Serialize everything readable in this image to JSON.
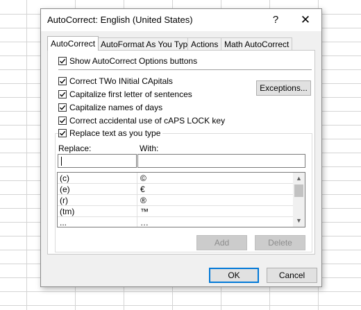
{
  "dialog": {
    "title": "AutoCorrect: English (United States)",
    "help_label": "?",
    "close_label": "✕"
  },
  "tabs": [
    {
      "label": "AutoCorrect",
      "active": true
    },
    {
      "label": "AutoFormat As You Type",
      "active": false
    },
    {
      "label": "Actions",
      "active": false
    },
    {
      "label": "Math AutoCorrect",
      "active": false
    }
  ],
  "options": {
    "show_buttons": {
      "label": "Show AutoCorrect Options buttons",
      "checked": true
    },
    "two_initial_caps": {
      "label": "Correct TWo INitial CApitals",
      "checked": true
    },
    "capitalize_sentences": {
      "label": "Capitalize first letter of sentences",
      "checked": true
    },
    "capitalize_days": {
      "label": "Capitalize names of days",
      "checked": true
    },
    "caps_lock": {
      "label": "Correct accidental use of cAPS LOCK key",
      "checked": true
    },
    "replace_text": {
      "label": "Replace text as you type",
      "checked": true
    }
  },
  "exceptions_label": "Exceptions...",
  "replace": {
    "label": "Replace:",
    "value": "",
    "with_label": "With:",
    "with_value": ""
  },
  "entries": [
    {
      "replace": "(c)",
      "with": "©"
    },
    {
      "replace": "(e)",
      "with": "€"
    },
    {
      "replace": "(r)",
      "with": "®"
    },
    {
      "replace": "(tm)",
      "with": "™"
    },
    {
      "replace": "...",
      "with": "…"
    }
  ],
  "buttons": {
    "add": "Add",
    "delete": "Delete",
    "ok": "OK",
    "cancel": "Cancel"
  },
  "icons": {
    "check": "checkmark-icon",
    "scroll_up": "chevron-up-icon",
    "scroll_down": "chevron-down-icon"
  }
}
